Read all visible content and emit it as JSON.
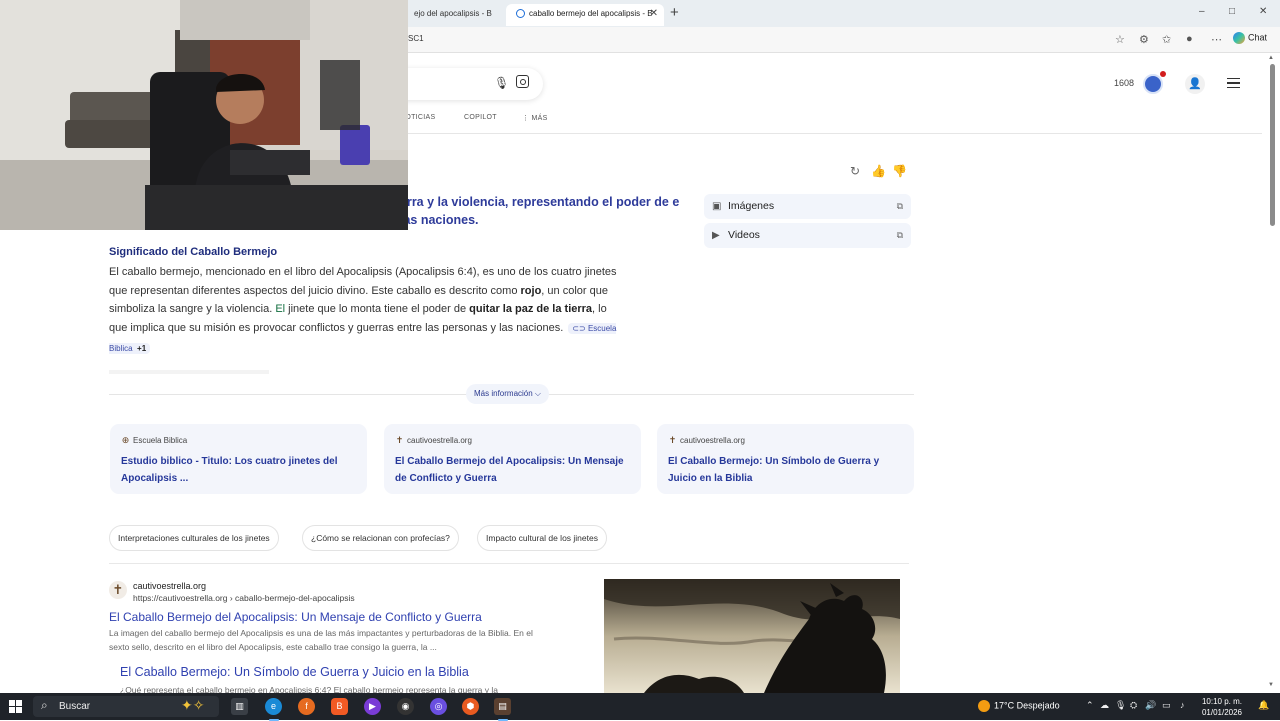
{
  "browser": {
    "tabs": [
      {
        "label": "ejo del apocalipsis - B"
      },
      {
        "label": "caballo bermejo del apocalipsis - B"
      }
    ],
    "new_tab": "+",
    "window_controls": {
      "minimize": "–",
      "maximize": "□",
      "close": "✕"
    },
    "url": "SC1",
    "chat_label": "Chat"
  },
  "bing": {
    "points": "1608",
    "nav_tabs": [
      "NOTICIAS",
      "COPILOT",
      "⋮ MÁS"
    ]
  },
  "answer": {
    "headline": "erra y la violencia, representando el poder de e las naciones.",
    "section_title": "Significado del Caballo Bermejo",
    "paragraph": {
      "p1": "El caballo bermejo, mencionado en el libro del Apocalipsis (Apocalipsis 6:4), es uno de los cuatro jinetes que representan diferentes aspectos del juicio divino. Este caballo es descrito como ",
      "b1": "rojo",
      "p2": ", un color que simboliza la sangre y la violencia. ",
      "g1": "El",
      "p3": " jinete que lo monta tiene el poder de ",
      "b2": "quitar la paz de la tierra",
      "p4": ", lo que implica que su misión es provocar conflictos y guerras entre las personas y las naciones.",
      "source_chip": "Escuela Biblica",
      "source_more": "+1"
    },
    "side_links": [
      {
        "label": "Imágenes"
      },
      {
        "label": "Videos"
      }
    ],
    "more_info": "Más información ⌵"
  },
  "cards": [
    {
      "source": "Escuela Biblica",
      "title": "Estudio biblico - Titulo: Los cuatro jinetes del Apocalipsis ..."
    },
    {
      "source": "cautivoestrella.org",
      "title": "El Caballo Bermejo del Apocalipsis: Un Mensaje de Conflicto y Guerra"
    },
    {
      "source": "cautivoestrella.org",
      "title": "El Caballo Bermejo: Un Símbolo de Guerra y Juicio en la Biblia"
    }
  ],
  "suggestions": [
    "Interpretaciones culturales de los jinetes",
    "¿Cómo se relacionan con profecías?",
    "Impacto cultural de los jinetes"
  ],
  "result": {
    "site": "cautivoestrella.org",
    "url": "https://cautivoestrella.org › caballo-bermejo-del-apocalipsis",
    "title": "El Caballo Bermejo del Apocalipsis: Un Mensaje de Conflicto y Guerra",
    "description": "La imagen del caballo bermejo del Apocalipsis es una de las más impactantes y perturbadoras de la Biblia. En el sexto sello, descrito en el libro del Apocalipsis, este caballo trae consigo la guerra, la ...",
    "sub_title": "El Caballo Bermejo: Un Símbolo de Guerra y Juicio en la Biblia",
    "sub_description": "¿Qué representa el caballo bermejo en Apocalipsis 6:4? El caballo bermejo representa la guerra y la"
  },
  "taskbar": {
    "search_label": "Buscar",
    "weather": "17°C  Despejado",
    "time": "10:10 p. m.",
    "date": "01/01/2026"
  },
  "colors": {
    "link": "#3041b0",
    "headline": "#2e3b9a",
    "taskbar": "#1f2329"
  }
}
